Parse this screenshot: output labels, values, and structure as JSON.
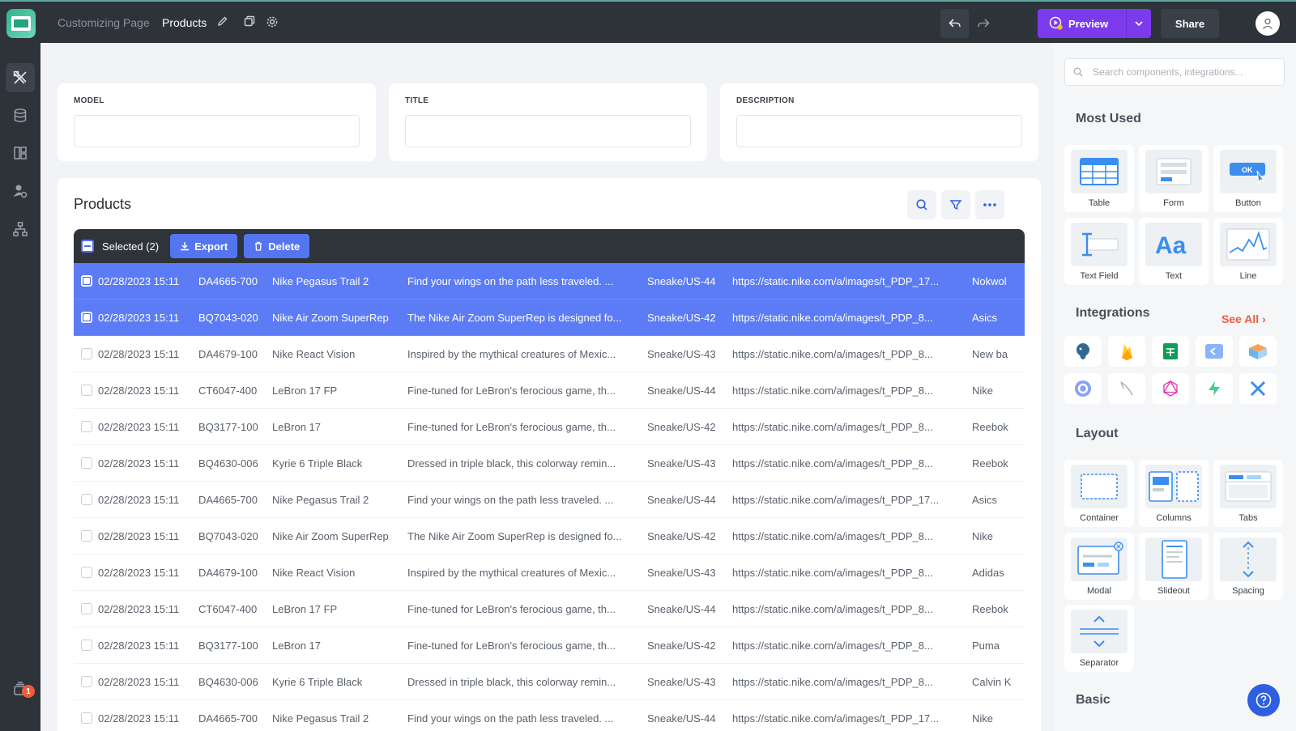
{
  "header": {
    "breadcrumb_parent": "Customizing Page",
    "page_name": "Products",
    "preview_label": "Preview",
    "share_label": "Share"
  },
  "sidebar": {
    "items": [
      {
        "icon": "design-tools-icon",
        "active": true
      },
      {
        "icon": "database-icon",
        "active": false
      },
      {
        "icon": "layout-grid-icon",
        "active": false
      },
      {
        "icon": "users-gear-icon",
        "active": false
      },
      {
        "icon": "hierarchy-icon",
        "active": false
      }
    ],
    "notifications_count": "1"
  },
  "filters": [
    {
      "label": "MODEL",
      "value": ""
    },
    {
      "label": "TITLE",
      "value": ""
    },
    {
      "label": "DESCRIPTION",
      "value": ""
    }
  ],
  "table": {
    "title": "Products",
    "selected_text": "Selected (2)",
    "export_label": "Export",
    "delete_label": "Delete",
    "rows": [
      {
        "selected": true,
        "date": "02/28/2023 15:11",
        "model": "DA4665-700",
        "title": "Nike Pegasus Trail 2",
        "description": "Find your wings on the path less traveled. ...",
        "sku": "Sneake/US-44",
        "image": "https://static.nike.com/a/images/t_PDP_17...",
        "brand": "Nokwol"
      },
      {
        "selected": true,
        "date": "02/28/2023 15:11",
        "model": "BQ7043-020",
        "title": "Nike Air Zoom SuperRep",
        "description": "The Nike Air Zoom SuperRep is designed fo...",
        "sku": "Sneake/US-42",
        "image": "https://static.nike.com/a/images/t_PDP_8...",
        "brand": "Asics"
      },
      {
        "selected": false,
        "date": "02/28/2023 15:11",
        "model": "DA4679-100",
        "title": "Nike React Vision",
        "description": "Inspired by the mythical creatures of Mexic...",
        "sku": "Sneake/US-43",
        "image": "https://static.nike.com/a/images/t_PDP_8...",
        "brand": "New ba"
      },
      {
        "selected": false,
        "date": "02/28/2023 15:11",
        "model": "CT6047-400",
        "title": "LeBron 17 FP",
        "description": "Fine-tuned for LeBron's ferocious game, th...",
        "sku": "Sneake/US-44",
        "image": "https://static.nike.com/a/images/t_PDP_8...",
        "brand": "Nike"
      },
      {
        "selected": false,
        "date": "02/28/2023 15:11",
        "model": "BQ3177-100",
        "title": "LeBron 17",
        "description": "Fine-tuned for LeBron's ferocious game, th...",
        "sku": "Sneake/US-42",
        "image": "https://static.nike.com/a/images/t_PDP_8...",
        "brand": "Reebok"
      },
      {
        "selected": false,
        "date": "02/28/2023 15:11",
        "model": "BQ4630-006",
        "title": "Kyrie 6 Triple Black",
        "description": "Dressed in triple black, this colorway remin...",
        "sku": "Sneake/US-43",
        "image": "https://static.nike.com/a/images/t_PDP_8...",
        "brand": "Reebok"
      },
      {
        "selected": false,
        "date": "02/28/2023 15:11",
        "model": "DA4665-700",
        "title": "Nike Pegasus Trail 2",
        "description": "Find your wings on the path less traveled. ...",
        "sku": "Sneake/US-44",
        "image": "https://static.nike.com/a/images/t_PDP_17...",
        "brand": "Asics"
      },
      {
        "selected": false,
        "date": "02/28/2023 15:11",
        "model": "BQ7043-020",
        "title": "Nike Air Zoom SuperRep",
        "description": "The Nike Air Zoom SuperRep is designed fo...",
        "sku": "Sneake/US-42",
        "image": "https://static.nike.com/a/images/t_PDP_8...",
        "brand": "Nike"
      },
      {
        "selected": false,
        "date": "02/28/2023 15:11",
        "model": "DA4679-100",
        "title": "Nike React Vision",
        "description": "Inspired by the mythical creatures of Mexic...",
        "sku": "Sneake/US-43",
        "image": "https://static.nike.com/a/images/t_PDP_8...",
        "brand": "Adidas"
      },
      {
        "selected": false,
        "date": "02/28/2023 15:11",
        "model": "CT6047-400",
        "title": "LeBron 17 FP",
        "description": "Fine-tuned for LeBron's ferocious game, th...",
        "sku": "Sneake/US-44",
        "image": "https://static.nike.com/a/images/t_PDP_8...",
        "brand": "Reebok"
      },
      {
        "selected": false,
        "date": "02/28/2023 15:11",
        "model": "BQ3177-100",
        "title": "LeBron 17",
        "description": "Fine-tuned for LeBron's ferocious game, th...",
        "sku": "Sneake/US-42",
        "image": "https://static.nike.com/a/images/t_PDP_8...",
        "brand": "Puma"
      },
      {
        "selected": false,
        "date": "02/28/2023 15:11",
        "model": "BQ4630-006",
        "title": "Kyrie 6 Triple Black",
        "description": "Dressed in triple black, this colorway remin...",
        "sku": "Sneake/US-43",
        "image": "https://static.nike.com/a/images/t_PDP_8...",
        "brand": "Calvin K"
      },
      {
        "selected": false,
        "date": "02/28/2023 15:11",
        "model": "DA4665-700",
        "title": "Nike Pegasus Trail 2",
        "description": "Find your wings on the path less traveled. ...",
        "sku": "Sneake/US-44",
        "image": "https://static.nike.com/a/images/t_PDP_17...",
        "brand": "Nike"
      }
    ]
  },
  "panel": {
    "search_placeholder": "Search components, integrations...",
    "most_used_title": "Most Used",
    "most_used": [
      "Table",
      "Form",
      "Button",
      "Text Field",
      "Text",
      "Line"
    ],
    "button_preview_text": "OK",
    "text_preview_glyph": "Aa",
    "integrations_title": "Integrations",
    "see_all_label": "See All",
    "integrations": [
      "postgres-icon",
      "firebase-icon",
      "google-sheets-icon",
      "api-icon",
      "box-icon",
      "circle-ci-icon",
      "brush-icon",
      "graphql-icon",
      "supabase-icon",
      "close-x-icon"
    ],
    "layout_title": "Layout",
    "layout": [
      "Container",
      "Columns",
      "Tabs",
      "Modal",
      "Slideout",
      "Spacing",
      "Separator"
    ],
    "basic_title": "Basic"
  },
  "colors": {
    "accent": "#7c3aed",
    "selection": "#5b7cf4",
    "see_all": "#ef5b3b"
  }
}
